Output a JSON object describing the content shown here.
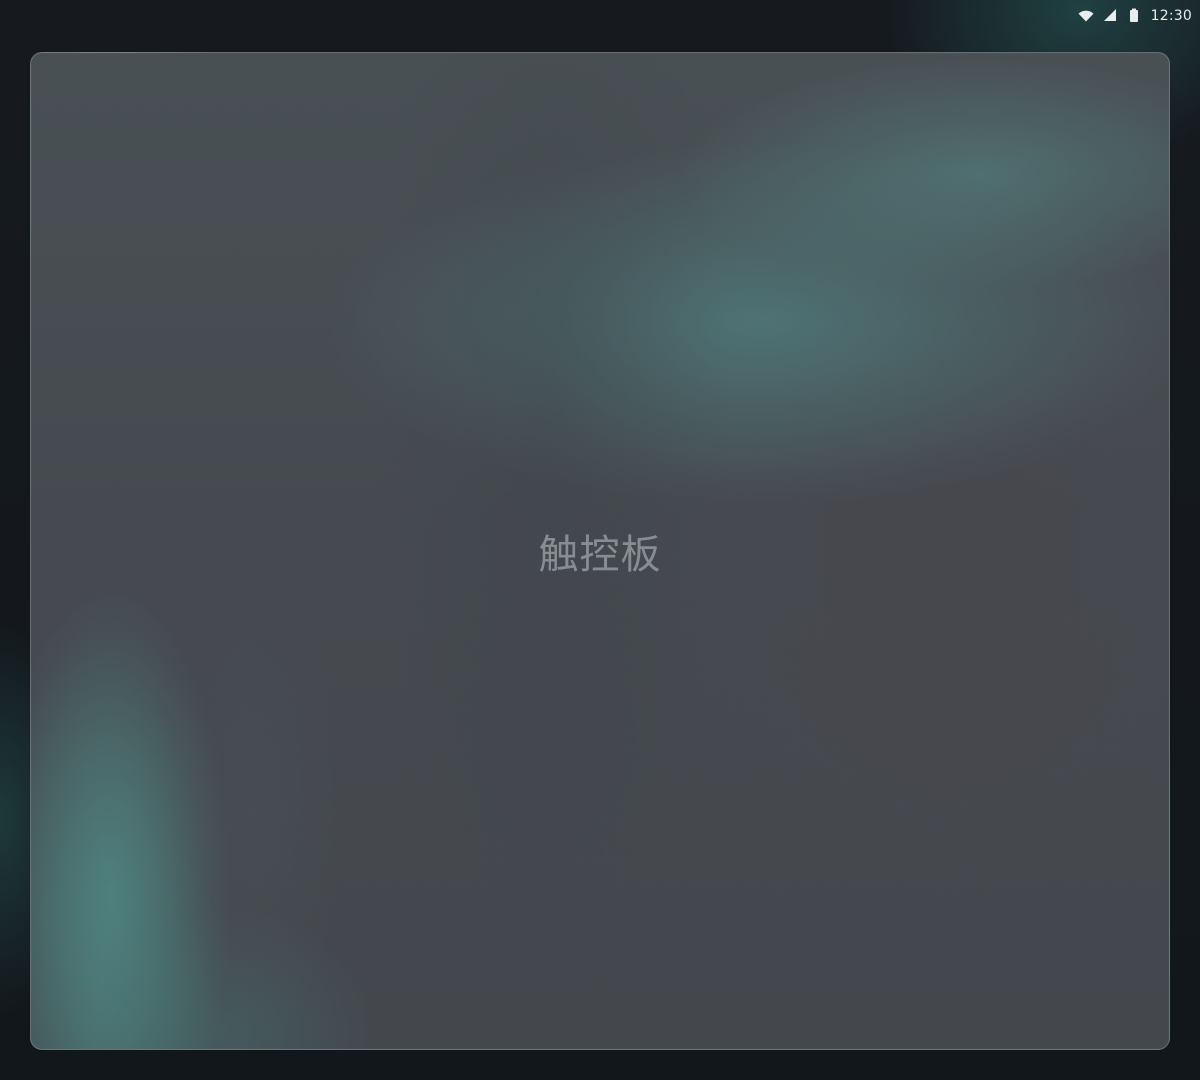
{
  "status_bar": {
    "time": "12:30",
    "icons": [
      "wifi-icon",
      "signal-icon",
      "battery-icon"
    ]
  },
  "touchpad": {
    "label": "触控板"
  },
  "colors": {
    "background": "#14181d",
    "panel": "#464a50",
    "panel_border": "#b0b8ba",
    "accent": "#4f7f80",
    "label": "#969da0",
    "status_text": "#e8eeee"
  }
}
